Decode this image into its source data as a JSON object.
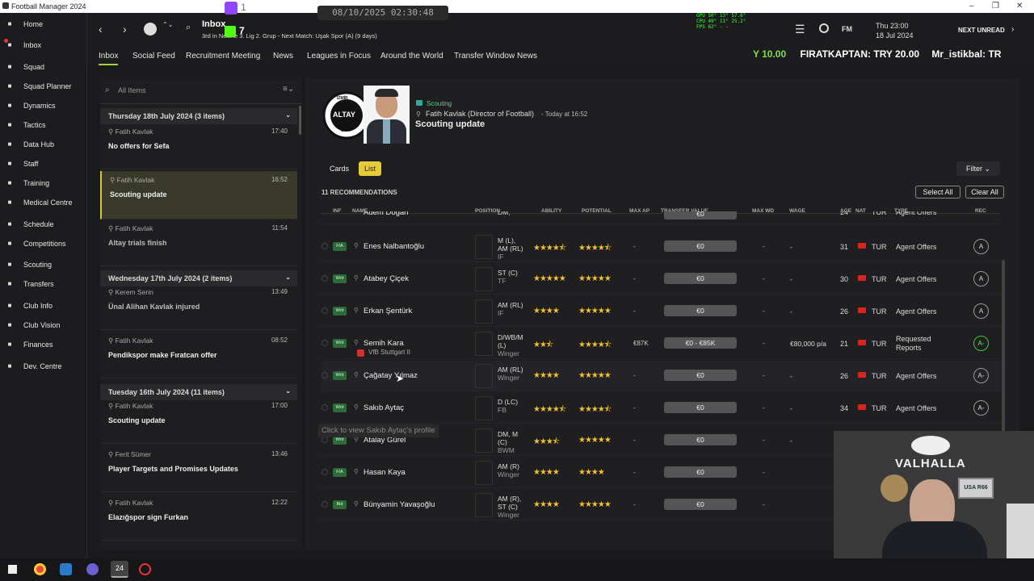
{
  "window": {
    "title": "Football Manager 2024",
    "min": "–",
    "max": "❐",
    "close": "✕"
  },
  "sidebar": {
    "items": [
      {
        "label": "Home",
        "icon": "home-icon"
      },
      {
        "label": "Inbox",
        "icon": "inbox-icon"
      },
      {
        "label": "Squad",
        "icon": "squad-icon"
      },
      {
        "label": "Squad Planner",
        "icon": "planner-icon"
      },
      {
        "label": "Dynamics",
        "icon": "dynamics-icon"
      },
      {
        "label": "Tactics",
        "icon": "tactics-icon"
      },
      {
        "label": "Data Hub",
        "icon": "datahub-icon"
      },
      {
        "label": "Staff",
        "icon": "staff-icon"
      },
      {
        "label": "Training",
        "icon": "training-icon"
      },
      {
        "label": "Medical Centre",
        "icon": "medical-icon"
      },
      {
        "label": "Schedule",
        "icon": "schedule-icon"
      },
      {
        "label": "Competitions",
        "icon": "trophy-icon"
      },
      {
        "label": "Scouting",
        "icon": "scouting-icon"
      },
      {
        "label": "Transfers",
        "icon": "transfers-icon"
      },
      {
        "label": "Club Info",
        "icon": "shield-icon"
      },
      {
        "label": "Club Vision",
        "icon": "vision-icon"
      },
      {
        "label": "Finances",
        "icon": "finances-icon"
      },
      {
        "label": "Dev. Centre",
        "icon": "dev-icon"
      }
    ]
  },
  "topbar": {
    "page_title": "Inbox",
    "sub": "3rd in Nesine 3. Lig 2. Grup - Next Match: Uşak Spor (A) (9 days)",
    "timestamp": "08/10/2025 02:30:48",
    "date_line1": "Thu 23:00",
    "date_line2": "18 Jul 2024",
    "next_unread": "NEXT UNREAD",
    "fm": "FM",
    "twitch_count": "1",
    "kick_count": "7",
    "stats": [
      "GPU  50°   13°  57.6°",
      "CPU  49°   11°  25.2°",
      "FPS  62°   -       -"
    ]
  },
  "ticker": {
    "items": [
      "Y 10.00",
      "FIRATKAPTAN: TRY 20.00",
      "Mr_istikbal: TR"
    ]
  },
  "tabs": [
    "Inbox",
    "Social Feed",
    "Recruitment Meeting",
    "News",
    "Leagues in Focus",
    "Around the World",
    "Transfer Window News"
  ],
  "inbox": {
    "search_placeholder": "All Items",
    "groups": [
      {
        "label": "Thursday 18th July 2024 (3 items)"
      },
      {
        "label": "Wednesday 17th July 2024 (2 items)"
      },
      {
        "label": "Tuesday 16th July 2024 (11 items)"
      }
    ],
    "messages": [
      {
        "from": "Fatih Kavlak",
        "subject": "No offers for Sefa",
        "time": "17:40"
      },
      {
        "from": "Fatih Kavlak",
        "subject": "Scouting update",
        "time": "16:52"
      },
      {
        "from": "Fatih Kavlak",
        "subject": "Altay trials finish",
        "time": "11:54"
      },
      {
        "from": "Kerem Serin",
        "subject": "Ünal Alihan Kavlak injured",
        "time": "13:49"
      },
      {
        "from": "Fatih Kavlak",
        "subject": "Pendikspor make Fıratcan offer",
        "time": "08:52"
      },
      {
        "from": "Fatih Kavlak",
        "subject": "Scouting update",
        "time": "17:00"
      },
      {
        "from": "Ferit Sümer",
        "subject": "Player Targets and Promises Updates",
        "time": "13:46"
      },
      {
        "from": "Fatih Kavlak",
        "subject": "Elazığspor sign Furkan",
        "time": "12:22"
      }
    ]
  },
  "message": {
    "club_badge": "ALTAY",
    "club_top": "İZMİR",
    "club_year": "1914",
    "category": "Scouting",
    "sender": "Fatih Kavlak  (Director of Football)",
    "when": "Today at 16:52",
    "subject": "Scouting update",
    "view_cards": "Cards",
    "view_list": "List",
    "filter": "Filter",
    "count": "11 RECOMMENDATIONS",
    "select_all": "Select All",
    "clear_all": "Clear All",
    "headers": [
      "INF",
      "NAME",
      "POSITION",
      "ABILITY",
      "POTENTIAL",
      "MAX AP",
      "TRANSFER VALUE",
      "MAX WD",
      "WAGE",
      "AGE",
      "NAT",
      "TYPE",
      "REC"
    ],
    "tooltip": "Click to view Sakıb Aytaç's profile",
    "partial_row": {
      "name": "Adem Doğan",
      "pos1": "DM,",
      "pos2": "BPD",
      "value": "€0",
      "age": "24",
      "nat": "TUR",
      "type": "Agent Offers"
    },
    "players": [
      {
        "inf": "F/A",
        "name": "Enes Nalbantoğlu",
        "club": "",
        "pos1": "M (L),",
        "pos2": "AM (RL)",
        "role": "IF",
        "ability": "★★★★⯪",
        "potential": "★★★★⯪",
        "max_ap": "-",
        "value": "€0",
        "max_wd": "-",
        "wage": "-",
        "age": "31",
        "nat": "TUR",
        "type": "Agent Offers",
        "type2": "",
        "rec": "A",
        "green": false
      },
      {
        "inf": "Wnt",
        "name": "Atabey Çiçek",
        "club": "",
        "pos1": "ST (C)",
        "pos2": "",
        "role": "TF",
        "ability": "★★★★★",
        "potential": "★★★★★",
        "max_ap": "-",
        "value": "€0",
        "max_wd": "-",
        "wage": "-",
        "age": "30",
        "nat": "TUR",
        "type": "Agent Offers",
        "type2": "",
        "rec": "A",
        "green": false
      },
      {
        "inf": "Wnt",
        "name": "Erkan Şentürk",
        "club": "",
        "pos1": "AM (RL)",
        "pos2": "",
        "role": "IF",
        "ability": "★★★★",
        "potential": "★★★★★",
        "max_ap": "-",
        "value": "€0",
        "max_wd": "-",
        "wage": "-",
        "age": "26",
        "nat": "TUR",
        "type": "Agent Offers",
        "type2": "",
        "rec": "A",
        "green": false
      },
      {
        "inf": "Wnt",
        "name": "Semih Kara",
        "club": "VfB Stuttgart II",
        "pos1": "D/WB/M",
        "pos2": "(L)",
        "role": "Winger",
        "ability": "★★⯪",
        "potential": "★★★★⯪",
        "max_ap": "€87K",
        "value": "€0 - €85K",
        "max_wd": "-",
        "wage": "€80,000 p/a",
        "age": "21",
        "nat": "TUR",
        "type": "Requested",
        "type2": "Reports",
        "rec": "A-",
        "green": true
      },
      {
        "inf": "Wnt",
        "name": "Çağatay Yılmaz",
        "club": "",
        "pos1": "AM (RL)",
        "pos2": "",
        "role": "Winger",
        "ability": "★★★★",
        "potential": "★★★★★",
        "max_ap": "-",
        "value": "€0",
        "max_wd": "-",
        "wage": "-",
        "age": "26",
        "nat": "TUR",
        "type": "Agent Offers",
        "type2": "",
        "rec": "A-",
        "green": false
      },
      {
        "inf": "Wnt",
        "name": "Sakıb Aytaç",
        "club": "",
        "pos1": "D (LC)",
        "pos2": "",
        "role": "FB",
        "ability": "★★★★⯪",
        "potential": "★★★★⯪",
        "max_ap": "-",
        "value": "€0",
        "max_wd": "-",
        "wage": "-",
        "age": "34",
        "nat": "TUR",
        "type": "Agent Offers",
        "type2": "",
        "rec": "A-",
        "green": false
      },
      {
        "inf": "Wnt",
        "name": "Atalay Gürel",
        "club": "",
        "pos1": "DM, M",
        "pos2": "(C)",
        "role": "BWM",
        "ability": "★★★⯪",
        "potential": "★★★★★",
        "max_ap": "-",
        "value": "€0",
        "max_wd": "-",
        "wage": "-",
        "age": "",
        "nat": "",
        "type": "",
        "type2": "",
        "rec": "",
        "green": false
      },
      {
        "inf": "F/A",
        "name": "Hasan Kaya",
        "club": "",
        "pos1": "AM (R)",
        "pos2": "",
        "role": "Winger",
        "ability": "★★★★",
        "potential": "★★★★",
        "max_ap": "-",
        "value": "€0",
        "max_wd": "-",
        "wage": "",
        "age": "",
        "nat": "",
        "type": "",
        "type2": "",
        "rec": "",
        "green": false
      },
      {
        "inf": "Bid",
        "name": "Bünyamin Yavaşoğlu",
        "club": "",
        "pos1": "AM (R),",
        "pos2": "ST (C)",
        "role": "Winger",
        "ability": "★★★★",
        "potential": "★★★★★",
        "max_ap": "-",
        "value": "€0",
        "max_wd": "-",
        "wage": "",
        "age": "",
        "nat": "",
        "type": "",
        "type2": "",
        "rec": "",
        "green": false
      }
    ]
  },
  "webcam": {
    "banner": "VALHALLA",
    "plate": "USA R66"
  }
}
